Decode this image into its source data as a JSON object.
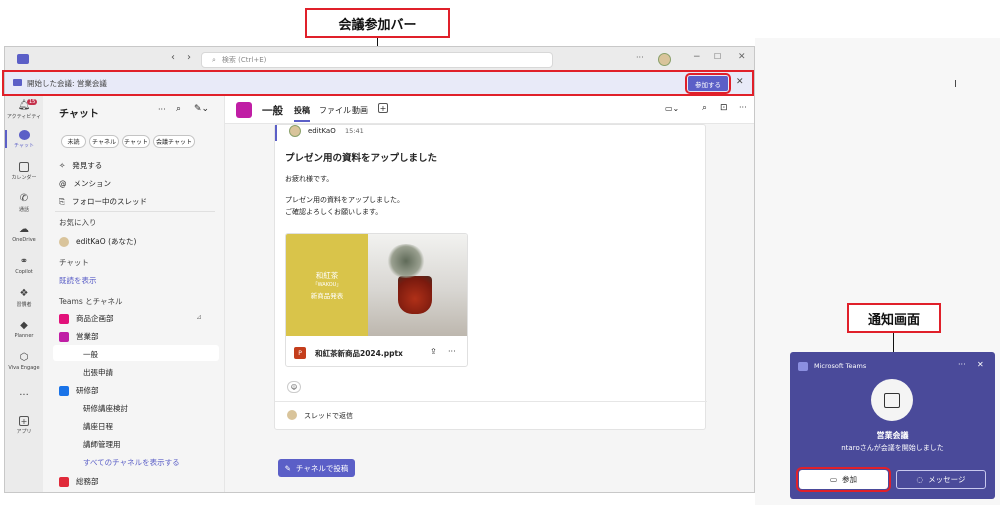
{
  "callouts": {
    "meeting_bar": "会議参加バー",
    "notification": "通知画面"
  },
  "window": {
    "search_placeholder": "検索 (Ctrl+E)"
  },
  "meeting_bar": {
    "text": "開始した会議: 営業会議",
    "join_label": "参加する"
  },
  "rail": {
    "items": [
      {
        "label": "アクティビティ",
        "icon": "bell-icon",
        "badge": "15"
      },
      {
        "label": "チャット",
        "icon": "chat-icon"
      },
      {
        "label": "カレンダー",
        "icon": "calendar-icon"
      },
      {
        "label": "通話",
        "icon": "phone-icon"
      },
      {
        "label": "OneDrive",
        "icon": "cloud-icon"
      },
      {
        "label": "Copilot",
        "icon": "copilot-icon"
      },
      {
        "label": "習慣者",
        "icon": "apps-icon"
      },
      {
        "label": "Planner",
        "icon": "planner-icon"
      },
      {
        "label": "Viva Engage",
        "icon": "viva-icon"
      },
      {
        "label": "アプリ",
        "icon": "add-app-icon"
      }
    ],
    "more": "..."
  },
  "chat_panel": {
    "title": "チャット",
    "filters": [
      "未読",
      "チャネル",
      "チャット",
      "会議チャット"
    ],
    "nav": [
      "発見する",
      "メンション",
      "フォロー中のスレッド"
    ],
    "favorites_header": "お気に入り",
    "favorite_user": "editKaO (あなた)",
    "chats_header": "チャット",
    "show_history": "既読を表示",
    "teams_header": "Teams とチャネル",
    "teams": [
      {
        "name": "商品企画部",
        "color": "#e2117a"
      },
      {
        "name": "営業部",
        "color": "#c01ea5"
      }
    ],
    "sales_channels": [
      "一般",
      "出張申請"
    ],
    "research_team": {
      "name": "研修部",
      "color": "#1a73e8"
    },
    "research_channels": [
      "研修講座検討",
      "講座日程",
      "講師管理用"
    ],
    "show_all_channels": "すべてのチャネルを表示する",
    "general_team": {
      "name": "総務部",
      "color": "#e02a3a"
    }
  },
  "channel": {
    "name": "一般",
    "tabs": [
      "投稿",
      "ファイル",
      "動画"
    ],
    "post": {
      "author": "editKaO",
      "time": "15:41",
      "title": "プレゼン用の資料をアップしました",
      "line1": "お疲れ様です。",
      "line2": "プレゼン用の資料をアップしました。",
      "line3": "ご確認よろしくお願いします。",
      "slide_title": "和紅茶",
      "slide_sub": "「WAKOU」",
      "slide_line": "新商品発表",
      "file_name": "和紅茶新商品2024.pptx",
      "reply_label": "スレッドで返信"
    },
    "post_button": "チャネルで投稿"
  },
  "notification": {
    "app_name": "Microsoft Teams",
    "meeting_name": "営業会議",
    "message": "ntaroさんが会議を開始しました",
    "join_label": "参加",
    "message_label": "メッセージ"
  },
  "colors": {
    "brand": "#5b5fc7",
    "callout_red": "#e0202a",
    "notif_bg": "#4a4a9a",
    "slide_yellow": "#d9c44a"
  }
}
